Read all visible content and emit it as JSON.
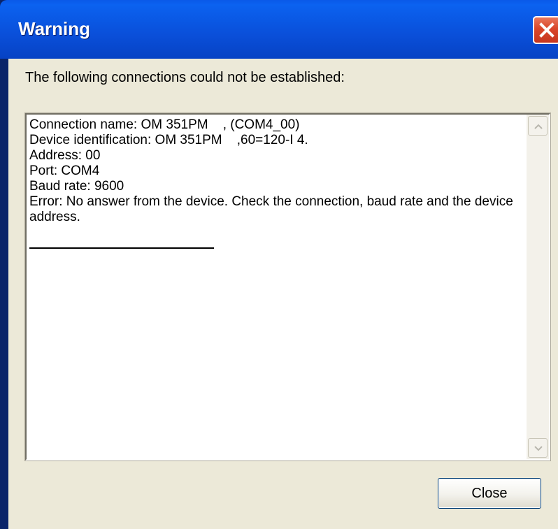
{
  "window": {
    "title": "Warning"
  },
  "dialog": {
    "message": "The following connections could not be established:",
    "details": [
      "Connection name: OM 351PM    , (COM4_00)",
      "Device identification: OM 351PM    ,60=120-I 4.",
      "Address: 00",
      "Port: COM4",
      "Baud rate: 9600",
      "Error: No answer from the device. Check the connection, baud rate and the device address."
    ],
    "close_label": "Close"
  },
  "icons": {
    "close": "close-icon",
    "scroll_up": "scroll-up-arrow-icon",
    "scroll_down": "scroll-down-arrow-icon"
  },
  "colors": {
    "title_bar": "#0a4fd9",
    "client_bg": "#ece9d8",
    "close_x": "#d9462a"
  }
}
